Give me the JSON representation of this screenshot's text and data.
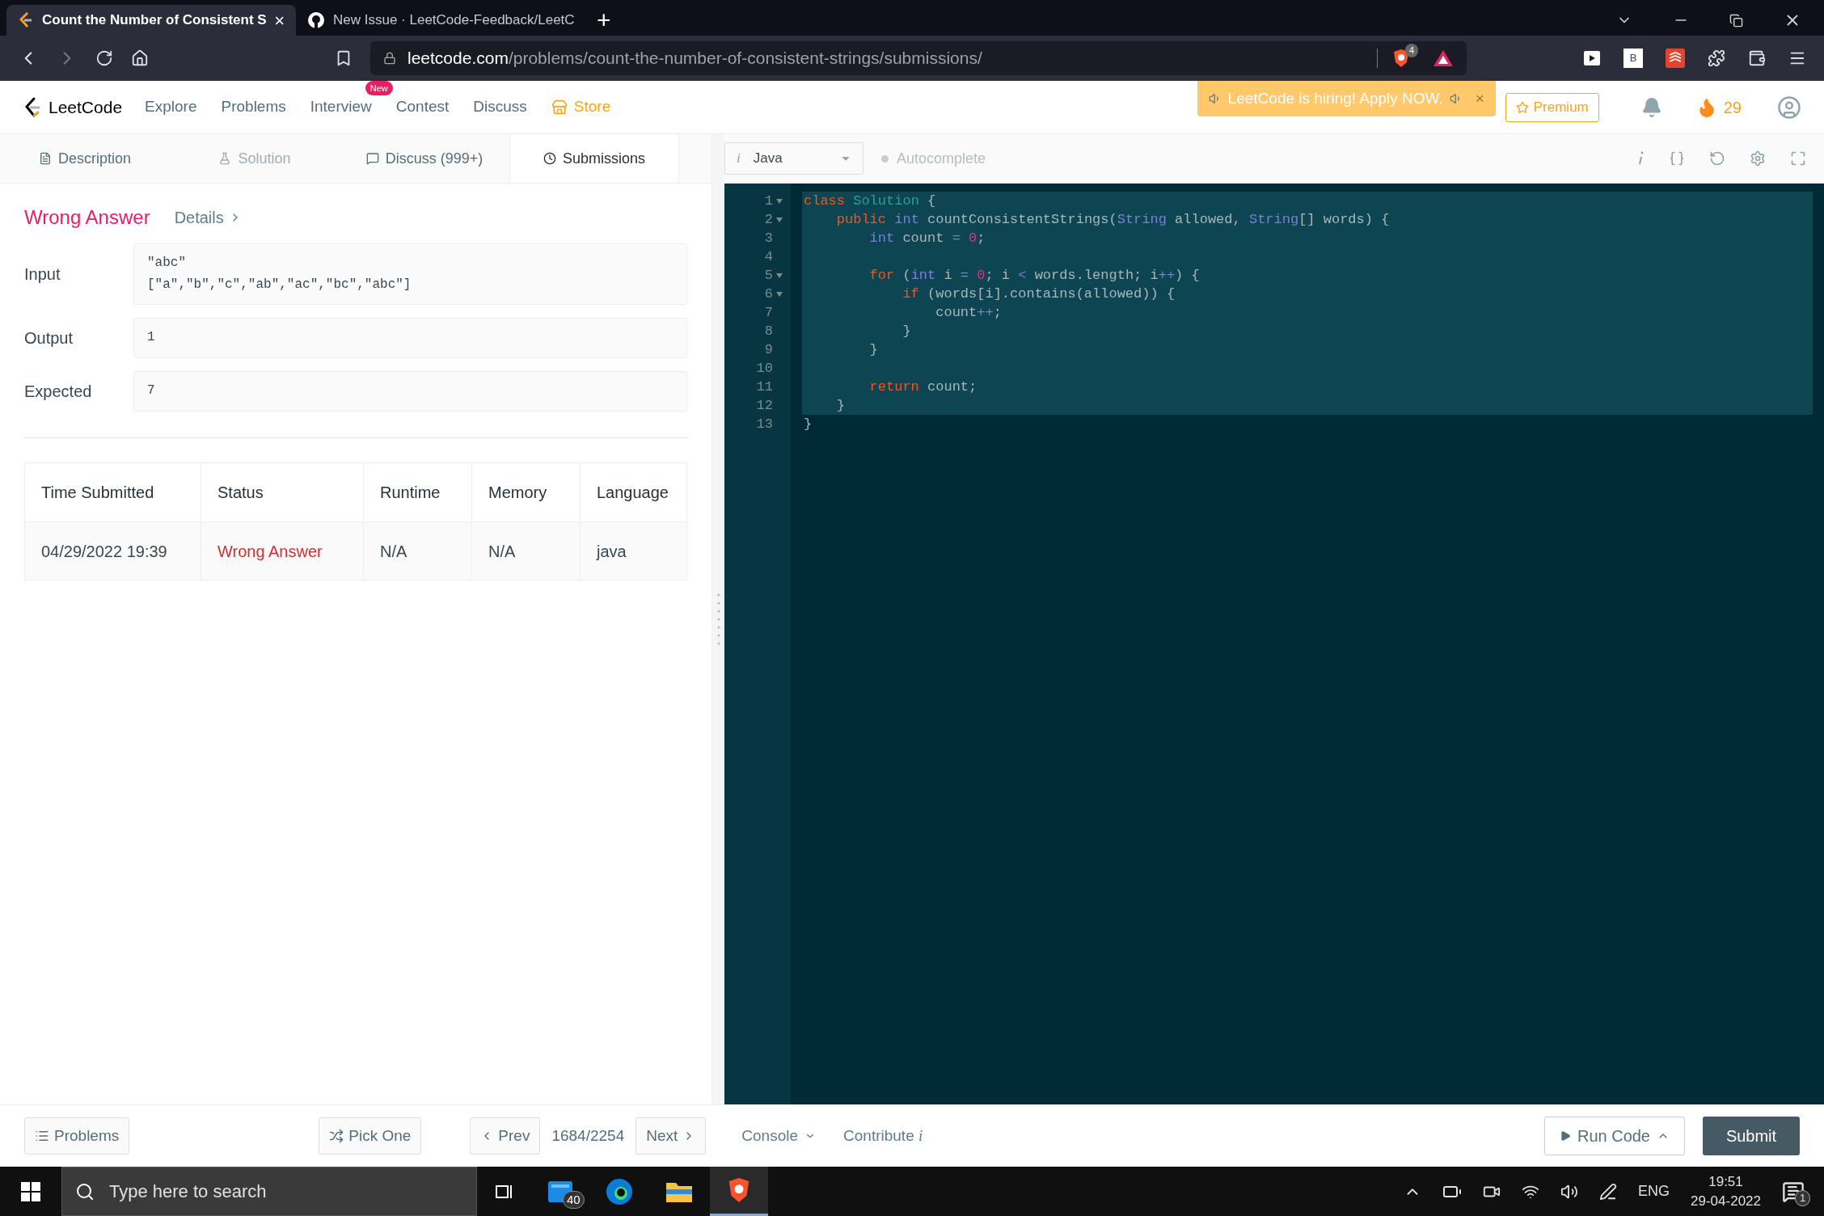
{
  "browser": {
    "tabs": [
      {
        "title": "Count the Number of Consistent S",
        "selected": true,
        "close": "×"
      },
      {
        "title": "New Issue · LeetCode-Feedback/LeetC",
        "selected": false
      }
    ],
    "new_tab": "+",
    "url": {
      "domain": "leetcode.com",
      "path": "/problems/count-the-number-of-consistent-strings/submissions/"
    },
    "shield_badge": "4",
    "extension_letter": "B"
  },
  "nav": {
    "logo": "LeetCode",
    "links": [
      {
        "label": "Explore",
        "kind": "link"
      },
      {
        "label": "Problems",
        "kind": "link"
      },
      {
        "label": "Interview",
        "kind": "link",
        "badge": "New"
      },
      {
        "label": "Contest",
        "kind": "link"
      },
      {
        "label": "Discuss",
        "kind": "link"
      },
      {
        "label": "Store",
        "kind": "store"
      }
    ],
    "banner": {
      "text": "LeetCode is hiring! Apply NOW.",
      "close": "×"
    },
    "premium": "Premium",
    "streak": "29"
  },
  "panel_tabs": [
    {
      "label": "Description",
      "selected": false,
      "disabled": false
    },
    {
      "label": "Solution",
      "selected": false,
      "disabled": true
    },
    {
      "label": "Discuss (999+)",
      "selected": false,
      "disabled": false
    },
    {
      "label": "Submissions",
      "selected": true,
      "disabled": false
    }
  ],
  "editor_toolbar": {
    "language_hint": "i",
    "language": "Java",
    "autocomplete": {
      "label": "Autocomplete",
      "on": false
    }
  },
  "result": {
    "status": "Wrong Answer",
    "details": "Details",
    "fields": [
      {
        "label": "Input",
        "lines": [
          "\"abc\"",
          "[\"a\",\"b\",\"c\",\"ab\",\"ac\",\"bc\",\"abc\"]"
        ]
      },
      {
        "label": "Output",
        "lines": [
          "1"
        ]
      },
      {
        "label": "Expected",
        "lines": [
          "7"
        ]
      }
    ]
  },
  "table": {
    "columns": [
      "Time Submitted",
      "Status",
      "Runtime",
      "Memory",
      "Language"
    ],
    "rows": [
      {
        "cells": [
          "04/29/2022 19:39",
          "Wrong Answer",
          "N/A",
          "N/A",
          "java"
        ]
      }
    ]
  },
  "code": [
    {
      "number": "1",
      "foldable": true,
      "active": true,
      "tokens": [
        {
          "text": "class",
          "kind": "keyword"
        },
        {
          "text": " Solution",
          "kind": "class"
        },
        {
          "text": " {",
          "kind": "plain"
        }
      ]
    },
    {
      "number": "2",
      "foldable": true,
      "active": true,
      "tokens": [
        {
          "text": "    public",
          "kind": "keyword"
        },
        {
          "text": " int",
          "kind": "type"
        },
        {
          "text": " countConsistentStrings(",
          "kind": "plain"
        },
        {
          "text": "String",
          "kind": "type"
        },
        {
          "text": " allowed, ",
          "kind": "plain"
        },
        {
          "text": "String",
          "kind": "type"
        },
        {
          "text": "[] words) {",
          "kind": "plain"
        }
      ]
    },
    {
      "number": "3",
      "foldable": false,
      "active": true,
      "tokens": [
        {
          "text": "        int",
          "kind": "type"
        },
        {
          "text": " count ",
          "kind": "plain"
        },
        {
          "text": "=",
          "kind": "operator"
        },
        {
          "text": " 0",
          "kind": "number"
        },
        {
          "text": ";",
          "kind": "plain"
        }
      ]
    },
    {
      "number": "4",
      "foldable": false,
      "active": true
    },
    {
      "number": "5",
      "foldable": true,
      "active": true,
      "tokens": [
        {
          "text": "        for",
          "kind": "keyword"
        },
        {
          "text": " (",
          "kind": "plain"
        },
        {
          "text": "int",
          "kind": "type"
        },
        {
          "text": " i ",
          "kind": "plain"
        },
        {
          "text": "=",
          "kind": "operator"
        },
        {
          "text": " 0",
          "kind": "number"
        },
        {
          "text": "; i ",
          "kind": "plain"
        },
        {
          "text": "<",
          "kind": "operator"
        },
        {
          "text": " words.length; i",
          "kind": "plain"
        },
        {
          "text": "++",
          "kind": "operator"
        },
        {
          "text": ") {",
          "kind": "plain"
        }
      ]
    },
    {
      "number": "6",
      "foldable": true,
      "active": true,
      "tokens": [
        {
          "text": "            if",
          "kind": "keyword"
        },
        {
          "text": " (words[i].contains(allowed)) {",
          "kind": "plain"
        }
      ]
    },
    {
      "number": "7",
      "foldable": false,
      "active": true,
      "tokens": [
        {
          "text": "                count",
          "kind": "plain"
        },
        {
          "text": "++",
          "kind": "operator"
        },
        {
          "text": ";",
          "kind": "plain"
        }
      ]
    },
    {
      "number": "8",
      "foldable": false,
      "active": true,
      "tokens": [
        {
          "text": "            }",
          "kind": "plain"
        }
      ]
    },
    {
      "number": "9",
      "foldable": false,
      "active": true,
      "tokens": [
        {
          "text": "        }",
          "kind": "plain"
        }
      ]
    },
    {
      "number": "10",
      "foldable": false,
      "active": true
    },
    {
      "number": "11",
      "foldable": false,
      "active": true,
      "tokens": [
        {
          "text": "        return",
          "kind": "keyword"
        },
        {
          "text": " count;",
          "kind": "plain"
        }
      ]
    },
    {
      "number": "12",
      "foldable": false,
      "active": true,
      "tokens": [
        {
          "text": "    }",
          "kind": "plain"
        }
      ]
    },
    {
      "number": "13",
      "foldable": false,
      "active": false,
      "tokens": [
        {
          "text": "}",
          "kind": "plain"
        }
      ]
    }
  ],
  "bottom_bar": {
    "problems": "Problems",
    "pick_one": "Pick One",
    "prev": "Prev",
    "counter": "1684/2254",
    "next": "Next",
    "console": "Console",
    "contribute": "Contribute",
    "contribute_hint": "i",
    "run_code": "Run Code",
    "submit": "Submit"
  },
  "taskbar": {
    "search_placeholder": "Type here to search",
    "mail_badge": "40",
    "language": "ENG",
    "time": "19:51",
    "date": "29-04-2022",
    "notifications": "1"
  }
}
